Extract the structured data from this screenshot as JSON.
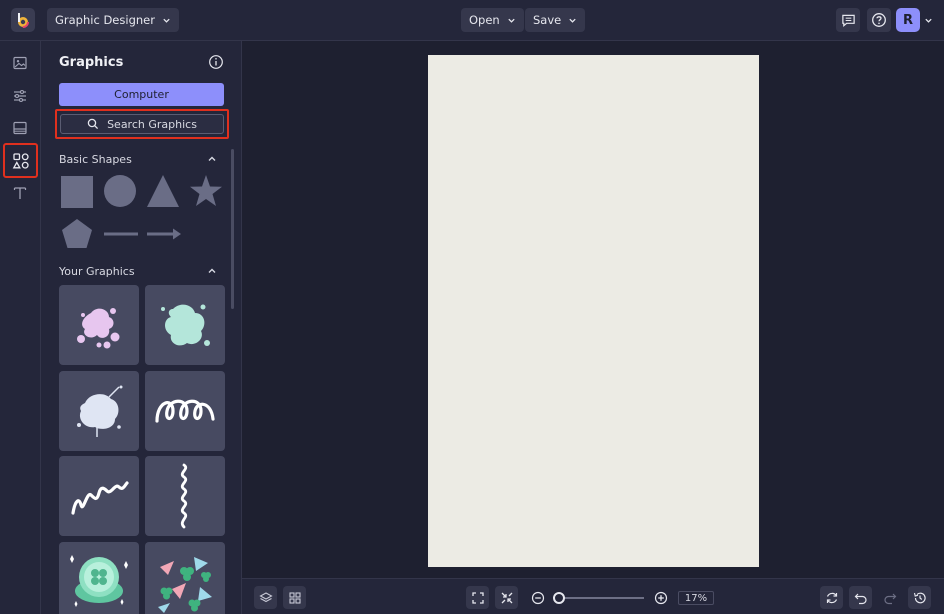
{
  "topbar": {
    "app_menu_label": "Graphic Designer",
    "open_label": "Open",
    "save_label": "Save",
    "avatar_initial": "R"
  },
  "panel": {
    "title": "Graphics",
    "computer_button": "Computer",
    "search_button": "Search Graphics",
    "basic_shapes_title": "Basic Shapes",
    "your_graphics_title": "Your Graphics",
    "basic_shapes": [
      "square-shape",
      "circle-shape",
      "triangle-shape",
      "star-shape",
      "pentagon-shape",
      "line-shape",
      "arrow-shape"
    ],
    "graphics": [
      "pink-splatter",
      "mint-splatter",
      "light-blue-splatter",
      "white-spiral",
      "white-zigzag",
      "white-wavy-line",
      "gold-coin-clover",
      "shamrock-confetti"
    ]
  },
  "bottombar": {
    "zoom_value": "17%"
  },
  "colors": {
    "accent": "#8d8ffb",
    "highlight": "#e0301e",
    "canvas": "#ecebe4",
    "panel_bg": "#24263a",
    "workspace_bg": "#1e2030"
  }
}
